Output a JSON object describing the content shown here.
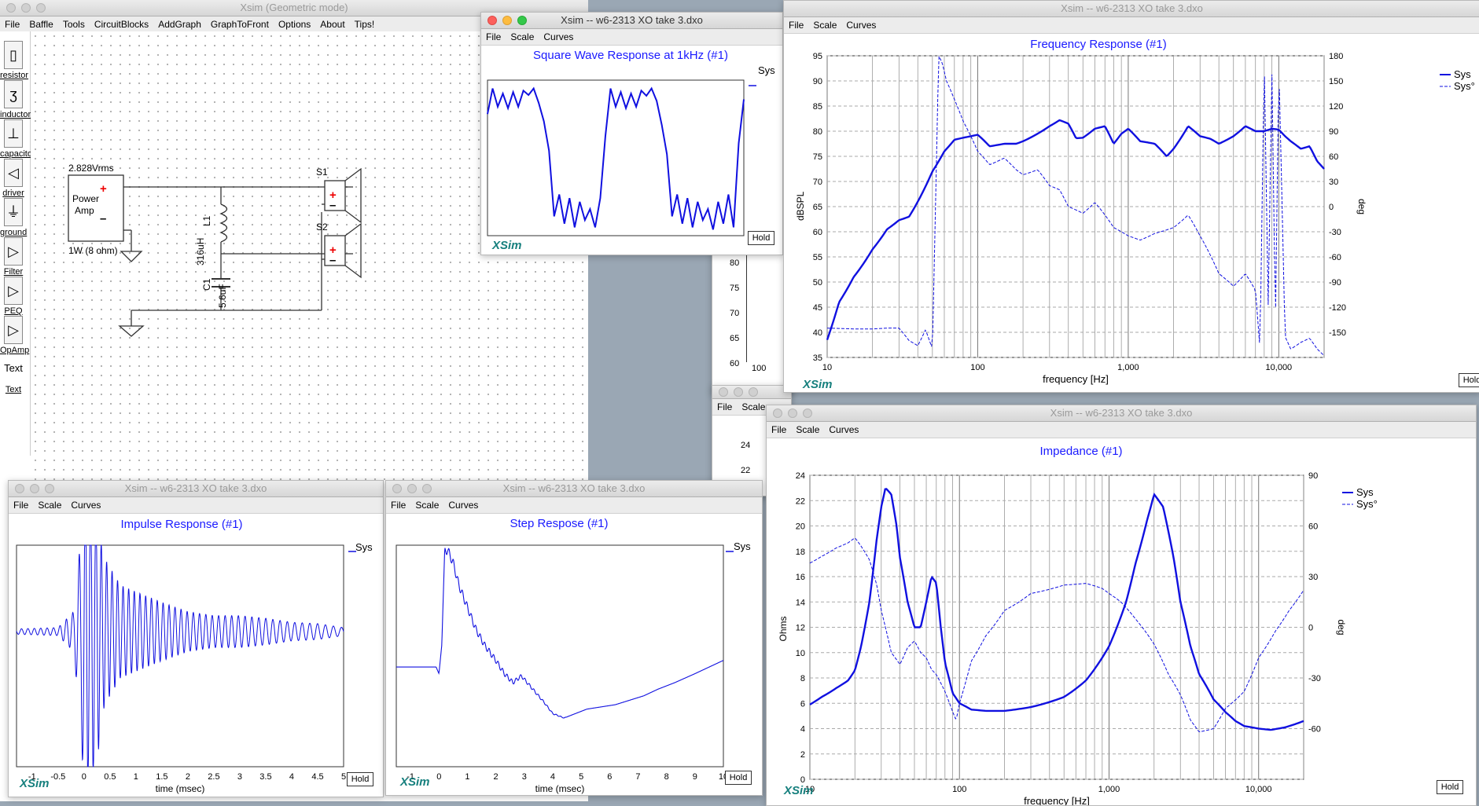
{
  "main_window": {
    "title": "Xsim (Geometric mode)",
    "menu": [
      "File",
      "Baffle",
      "Tools",
      "CircuitBlocks",
      "AddGraph",
      "GraphToFront",
      "Options",
      "About",
      "Tips!"
    ],
    "palette": [
      "resistor",
      "inductor",
      "capacitor",
      "driver",
      "ground",
      "Filter",
      "PEQ",
      "OpAmp",
      "Text"
    ],
    "palette_text_glyph": "Text",
    "schematic": {
      "source_voltage": "2.828Vrms",
      "source_label_1": "Power",
      "source_label_2": "Amp",
      "source_power": "1W (8 ohm)",
      "inductor_name": "L1",
      "inductor_value": "316uH",
      "capacitor_name": "C1",
      "capacitor_value": "5.6uF",
      "driver1": "S1",
      "driver2": "S2"
    }
  },
  "hidden_window": {
    "menu": [
      "File",
      "Scale"
    ],
    "y_ticks": [
      "80",
      "75",
      "70",
      "65",
      "60"
    ],
    "x_tick": "100",
    "y_ticks_2": [
      "24",
      "22"
    ]
  },
  "square_window": {
    "title": "Xsim -- w6-2313 XO take 3.dxo",
    "menu": [
      "File",
      "Scale",
      "Curves"
    ],
    "chart_title": "Square Wave Response at 1kHz (#1)",
    "legend": "Sys",
    "brand": "XSim",
    "hold": "Hold"
  },
  "freq_window": {
    "title": "Xsim -- w6-2313 XO take 3.dxo",
    "menu": [
      "File",
      "Scale",
      "Curves"
    ],
    "chart_title": "Frequency Response (#1)",
    "legend": [
      "Sys",
      "Sys°"
    ],
    "brand": "XSim",
    "hold": "Hold"
  },
  "impulse_window": {
    "title": "Xsim -- w6-2313 XO take 3.dxo",
    "menu": [
      "File",
      "Scale",
      "Curves"
    ],
    "chart_title": "Impulse Response (#1)",
    "legend": "Sys",
    "brand": "XSim",
    "hold": "Hold"
  },
  "step_window": {
    "title": "Xsim -- w6-2313 XO take 3.dxo",
    "menu": [
      "File",
      "Scale",
      "Curves"
    ],
    "chart_title": "Step Respose (#1)",
    "legend": "Sys",
    "brand": "XSim",
    "hold": "Hold"
  },
  "impedance_window": {
    "title": "Xsim -- w6-2313 XO take 3.dxo",
    "menu": [
      "File",
      "Scale",
      "Curves"
    ],
    "chart_title": "Impedance (#1)",
    "legend": [
      "Sys",
      "Sys°"
    ],
    "brand": "XSim",
    "hold": "Hold"
  },
  "colors": {
    "curve": "#1010e0",
    "title_blue": "#1a1aff",
    "brand_teal": "#17807e"
  },
  "chart_data": [
    {
      "id": "frequency",
      "type": "line",
      "title": "Frequency Response (#1)",
      "xlabel": "frequency [Hz]",
      "ylabel": "dBSPL",
      "y2label": "deg",
      "xscale": "log",
      "xlim": [
        10,
        20000
      ],
      "ylim": [
        35,
        95
      ],
      "y2lim": [
        -180,
        180
      ],
      "x_ticks": [
        "10",
        "100",
        "1,000",
        "10,000"
      ],
      "y_ticks": [
        "35",
        "40",
        "45",
        "50",
        "55",
        "60",
        "65",
        "70",
        "75",
        "80",
        "85",
        "90",
        "95"
      ],
      "y2_ticks": [
        "180",
        "150",
        "120",
        "90",
        "60",
        "30",
        "0",
        "-30",
        "-60",
        "-90",
        "-120",
        "-150"
      ],
      "grid": true,
      "legend_position": "right",
      "series": [
        {
          "name": "Sys",
          "axis": "left",
          "x": [
            10,
            12,
            15,
            20,
            25,
            30,
            35,
            40,
            50,
            60,
            70,
            80,
            100,
            120,
            150,
            180,
            200,
            250,
            300,
            350,
            400,
            450,
            500,
            600,
            700,
            800,
            900,
            1000,
            1200,
            1500,
            1800,
            2000,
            2500,
            3000,
            3500,
            4000,
            5000,
            6000,
            7000,
            8000,
            9000,
            10000,
            11000,
            12000,
            14000,
            16000,
            18000,
            20000
          ],
          "y": [
            38.5,
            46,
            51,
            56.5,
            60.5,
            62.3,
            63,
            66,
            72,
            76,
            78.3,
            78.7,
            79.3,
            77,
            77.5,
            77.5,
            78,
            79.5,
            81,
            82.2,
            81.5,
            78.6,
            78.7,
            80.5,
            81,
            77.5,
            79.5,
            80.5,
            78,
            77.5,
            75,
            76.5,
            81,
            79,
            78.5,
            77.5,
            79,
            81,
            80,
            80,
            80.5,
            80.3,
            79,
            78,
            76.5,
            77,
            74,
            72.5
          ]
        },
        {
          "name": "Sys°",
          "axis": "right",
          "x": [
            10,
            15,
            20,
            25,
            30,
            35,
            40,
            45,
            50,
            55,
            58,
            62,
            70,
            80,
            100,
            120,
            150,
            180,
            200,
            250,
            300,
            350,
            400,
            500,
            600,
            700,
            800,
            1000,
            1200,
            1500,
            2000,
            2500,
            3000,
            4000,
            5000,
            6000,
            7000,
            7500,
            8000,
            8500,
            9000,
            9500,
            10000,
            11000,
            12000,
            14000,
            16000,
            18000,
            20000
          ],
          "y": [
            -145,
            -146,
            -146,
            -145,
            -145,
            -160,
            -166,
            -147,
            -170,
            180,
            172,
            150,
            128,
            102,
            66,
            50,
            58,
            44,
            38,
            44,
            25,
            20,
            0,
            -8,
            5,
            -10,
            -25,
            -35,
            -40,
            -32,
            -25,
            -10,
            -35,
            -80,
            -95,
            -80,
            -100,
            -170,
            175,
            -120,
            160,
            -140,
            170,
            -155,
            -170,
            -162,
            -157,
            -170,
            -178
          ]
        }
      ]
    },
    {
      "id": "square",
      "type": "line",
      "title": "Square Wave Response at 1kHz (#1)",
      "series": [
        {
          "name": "Sys",
          "x": [
            0,
            0.02,
            0.04,
            0.06,
            0.08,
            0.1,
            0.12,
            0.14,
            0.16,
            0.18,
            0.2,
            0.22,
            0.24,
            0.26,
            0.28,
            0.3,
            0.32,
            0.34,
            0.36,
            0.38,
            0.4,
            0.42,
            0.44,
            0.46,
            0.48,
            0.5,
            0.52,
            0.54,
            0.56,
            0.58,
            0.6,
            0.62,
            0.64,
            0.66,
            0.68,
            0.7,
            0.72,
            0.74,
            0.76,
            0.78,
            0.8,
            0.82,
            0.84,
            0.86,
            0.88,
            0.9,
            0.92,
            0.94,
            0.96,
            0.98,
            1.0
          ],
          "y": [
            0.6,
            0.95,
            0.7,
            0.88,
            0.68,
            0.9,
            0.7,
            0.92,
            0.86,
            0.95,
            0.75,
            0.5,
            0.1,
            -0.8,
            -0.5,
            -0.9,
            -0.55,
            -0.95,
            -0.6,
            -0.85,
            -0.7,
            -0.95,
            -0.55,
            0.3,
            0.95,
            0.7,
            0.9,
            0.68,
            0.88,
            0.7,
            0.92,
            0.85,
            0.95,
            0.78,
            0.45,
            0.05,
            -0.8,
            -0.5,
            -0.9,
            -0.55,
            -0.95,
            -0.6,
            -0.85,
            -0.7,
            -0.98,
            -0.6,
            -0.9,
            -0.5,
            -0.95,
            0.2,
            0.8
          ]
        }
      ]
    },
    {
      "id": "impulse",
      "type": "line",
      "title": "Impulse Response (#1)",
      "xlabel": "time (msec)",
      "xlim": [
        -1.3,
        5
      ],
      "x_ticks": [
        "-1",
        "-0.5",
        "0",
        "0.5",
        "1",
        "1.5",
        "2",
        "2.5",
        "3",
        "3.5",
        "4",
        "4.5",
        "5"
      ],
      "series": [
        {
          "name": "Sys",
          "envelope_x": [
            -1.3,
            -0.5,
            -0.2,
            0,
            0.1,
            0.2,
            0.4,
            0.7,
            1,
            1.5,
            2,
            2.5,
            3,
            3.5,
            4,
            4.5,
            5
          ],
          "envelope_y": [
            0.02,
            0.03,
            0.15,
            0.95,
            1.0,
            0.9,
            0.55,
            0.35,
            0.3,
            0.22,
            0.15,
            0.12,
            0.12,
            0.1,
            0.07,
            0.06,
            0.03
          ]
        }
      ]
    },
    {
      "id": "step",
      "type": "line",
      "title": "Step Respose (#1)",
      "xlabel": "time (msec)",
      "xlim": [
        -1.5,
        10
      ],
      "x_ticks": [
        "-1",
        "0",
        "1",
        "2",
        "3",
        "4",
        "5",
        "6",
        "7",
        "8",
        "9",
        "10"
      ],
      "series": [
        {
          "name": "Sys",
          "x": [
            -1.5,
            -0.5,
            -0.1,
            0,
            0.1,
            0.2,
            0.3,
            0.5,
            0.7,
            1,
            1.3,
            1.6,
            2,
            2.3,
            2.6,
            2.9,
            3.3,
            3.7,
            4,
            4.4,
            4.8,
            5.2,
            5.7,
            6.2,
            6.7,
            7.2,
            7.7,
            8.3,
            9,
            9.5,
            10
          ],
          "y": [
            0.45,
            0.45,
            0.45,
            0.42,
            0.55,
            0.97,
            0.98,
            0.92,
            0.82,
            0.72,
            0.62,
            0.55,
            0.48,
            0.42,
            0.38,
            0.41,
            0.35,
            0.29,
            0.24,
            0.22,
            0.24,
            0.26,
            0.27,
            0.28,
            0.3,
            0.32,
            0.35,
            0.38,
            0.42,
            0.45,
            0.48
          ]
        }
      ]
    },
    {
      "id": "impedance",
      "type": "line",
      "title": "Impedance (#1)",
      "xlabel": "frequency [Hz]",
      "ylabel": "Ohms",
      "y2label": "deg",
      "xscale": "log",
      "xlim": [
        10,
        20000
      ],
      "ylim": [
        0,
        24
      ],
      "y2lim": [
        -90,
        90
      ],
      "x_ticks": [
        "10",
        "100",
        "1,000",
        "10,000"
      ],
      "y_ticks": [
        "0",
        "2",
        "4",
        "6",
        "8",
        "10",
        "12",
        "14",
        "16",
        "18",
        "20",
        "22",
        "24"
      ],
      "y2_ticks": [
        "90",
        "60",
        "30",
        "0",
        "-30",
        "-60"
      ],
      "grid": true,
      "legend_position": "right",
      "series": [
        {
          "name": "Sys",
          "axis": "left",
          "x": [
            10,
            12,
            15,
            18,
            20,
            22,
            25,
            28,
            30,
            32,
            35,
            38,
            40,
            45,
            50,
            55,
            60,
            65,
            70,
            75,
            80,
            90,
            100,
            120,
            150,
            200,
            300,
            500,
            700,
            1000,
            1300,
            1500,
            1800,
            2000,
            2300,
            2700,
            3000,
            3500,
            4000,
            5000,
            6000,
            7000,
            8000,
            10000,
            12000,
            15000,
            20000
          ],
          "y": [
            5.9,
            6.5,
            7.2,
            7.8,
            8.6,
            10.5,
            14,
            19,
            21.5,
            23,
            22.5,
            20,
            17.5,
            14,
            12,
            12,
            14,
            16,
            15.5,
            12,
            9.2,
            6.8,
            6,
            5.5,
            5.4,
            5.4,
            5.7,
            6.5,
            7.8,
            10.5,
            14,
            17,
            20.5,
            22.5,
            21.5,
            17.5,
            14,
            10.5,
            8.3,
            6.3,
            5.3,
            4.6,
            4.2,
            4,
            3.9,
            4.1,
            4.6
          ]
        },
        {
          "name": "Sys°",
          "axis": "right",
          "x": [
            10,
            12,
            15,
            18,
            20,
            22,
            25,
            28,
            30,
            35,
            40,
            45,
            50,
            55,
            60,
            65,
            70,
            80,
            90,
            95,
            100,
            120,
            150,
            200,
            300,
            500,
            700,
            900,
            1000,
            1200,
            1500,
            2000,
            2500,
            3000,
            3500,
            4000,
            5000,
            6000,
            8000,
            10000,
            13000,
            16000,
            20000
          ],
          "y": [
            38,
            42,
            47,
            50,
            53,
            48,
            40,
            25,
            10,
            -15,
            -22,
            -12,
            -8,
            -15,
            -18,
            -25,
            -28,
            -38,
            -50,
            -55,
            -45,
            -20,
            -5,
            10,
            20,
            25,
            26,
            23,
            20,
            15,
            5,
            -10,
            -28,
            -40,
            -55,
            -62,
            -60,
            -48,
            -38,
            -18,
            -2,
            10,
            22
          ]
        }
      ]
    }
  ]
}
